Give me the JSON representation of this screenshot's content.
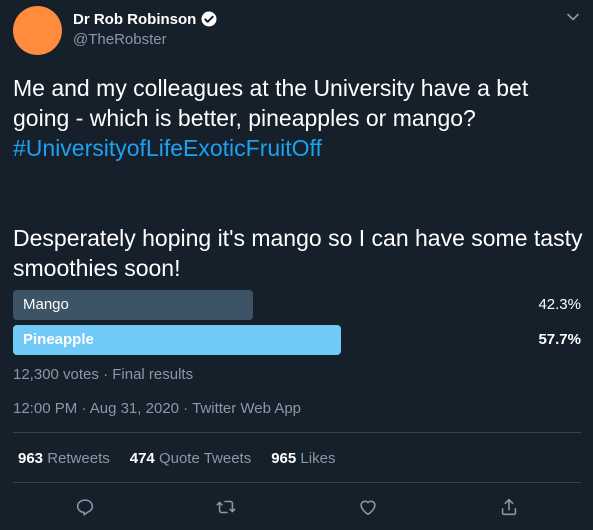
{
  "author": {
    "display_name": "Dr Rob Robinson",
    "handle": "@TheRobster",
    "verified": true,
    "avatar_color": "#ff8b3d"
  },
  "tweet": {
    "line1": "Me and my colleagues at the University have a bet going - which is better, pineapples or mango?",
    "hashtag": "#UniversityofLifeExoticFruitOff",
    "line2": "Desperately hoping it's mango so I can have some tasty smoothies soon!"
  },
  "poll": {
    "options": [
      {
        "label": "Mango",
        "percent_text": "42.3%",
        "percent": 42.3,
        "bar_color": "#3d5466",
        "winner": false
      },
      {
        "label": "Pineapple",
        "percent_text": "57.7%",
        "percent": 57.7,
        "bar_color": "#71c9f8",
        "winner": true
      }
    ],
    "meta": "12,300 votes · Final results"
  },
  "timestamp": {
    "time": "12:00 PM",
    "date": "Aug 31, 2020",
    "source": "Twitter Web App"
  },
  "stats": {
    "retweets_count": "963",
    "retweets_label": "Retweets",
    "quotes_count": "474",
    "quotes_label": "Quote Tweets",
    "likes_count": "965",
    "likes_label": "Likes"
  },
  "icons": {
    "reply": "reply-icon",
    "retweet": "retweet-icon",
    "like": "heart-icon",
    "share": "share-icon",
    "caret": "chevron-down-icon",
    "verified": "verified-badge-icon"
  },
  "colors": {
    "background": "#15202b",
    "accent": "#1da1f2",
    "secondary_text": "#8899a6"
  }
}
